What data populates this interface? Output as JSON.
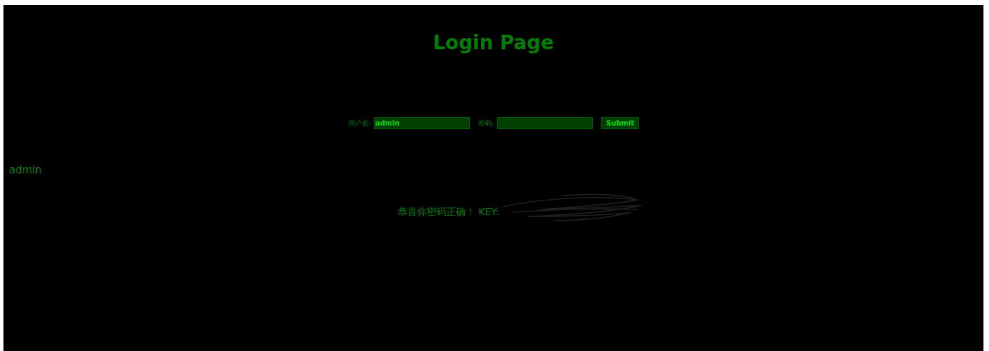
{
  "title": "Login Page",
  "form": {
    "username_label": "用户名:",
    "username_value": "admin",
    "password_label": "密码:",
    "submit": "Submit"
  },
  "echo": "admin",
  "message": "恭喜你密码正确！ KEY:"
}
